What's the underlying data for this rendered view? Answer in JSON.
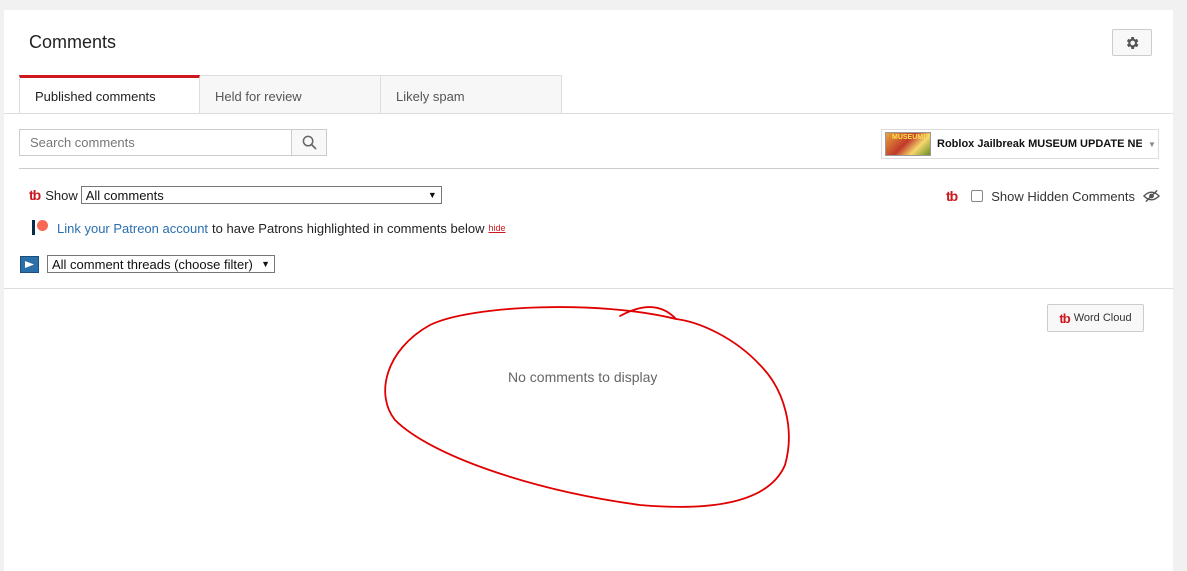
{
  "header": {
    "title": "Comments",
    "settings_icon": "gear-icon"
  },
  "tabs": [
    {
      "label": "Published comments",
      "active": true
    },
    {
      "label": "Held for review",
      "active": false
    },
    {
      "label": "Likely spam",
      "active": false
    }
  ],
  "search": {
    "placeholder": "Search comments",
    "value": "",
    "icon": "search-icon"
  },
  "video_selector": {
    "thumbnail_text": "MUSEUM!?",
    "title": "Roblox Jailbreak MUSEUM UPDATE NE…"
  },
  "filters": {
    "show_label": "Show",
    "show_value": "All comments",
    "show_hidden_label": "Show Hidden Comments",
    "thread_filter_value": "All comment threads (choose filter)"
  },
  "patreon": {
    "link_text": "Link your Patreon account",
    "message": "to have Patrons highlighted in comments below",
    "hide_label": "hide"
  },
  "word_cloud": {
    "label": "Word Cloud"
  },
  "empty_state": {
    "message": "No comments to display"
  },
  "colors": {
    "accent": "#cc181e",
    "link": "#2a6fb0",
    "annotation": "#e00000"
  }
}
